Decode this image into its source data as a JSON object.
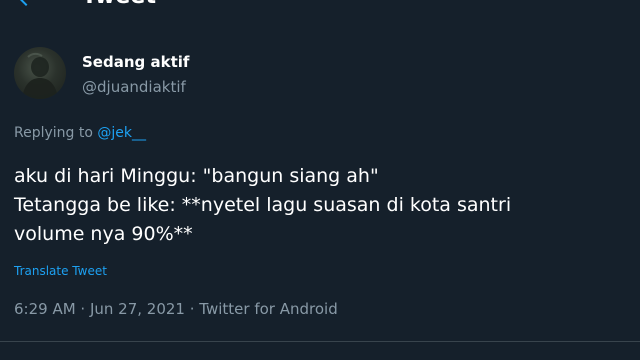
{
  "header": {
    "title": "Tweet",
    "back_icon": "back-arrow-icon"
  },
  "author": {
    "display_name": "Sedang aktif",
    "handle": "@djuandiaktif"
  },
  "reply": {
    "prefix": "Replying to ",
    "mention": "@jek__"
  },
  "tweet": {
    "lines": [
      "aku di hari Minggu: \"bangun siang ah\"",
      "Tetangga be like: **nyetel lagu suasan di kota santri",
      "volume nya 90%**"
    ],
    "translate_label": "Translate Tweet"
  },
  "meta": {
    "time": "6:29 AM",
    "separator": " · ",
    "date": "Jun 27, 2021",
    "source": "Twitter for Android"
  },
  "colors": {
    "background": "#15202b",
    "text_primary": "#ffffff",
    "text_secondary": "#8899a6",
    "accent": "#1da1f2"
  }
}
